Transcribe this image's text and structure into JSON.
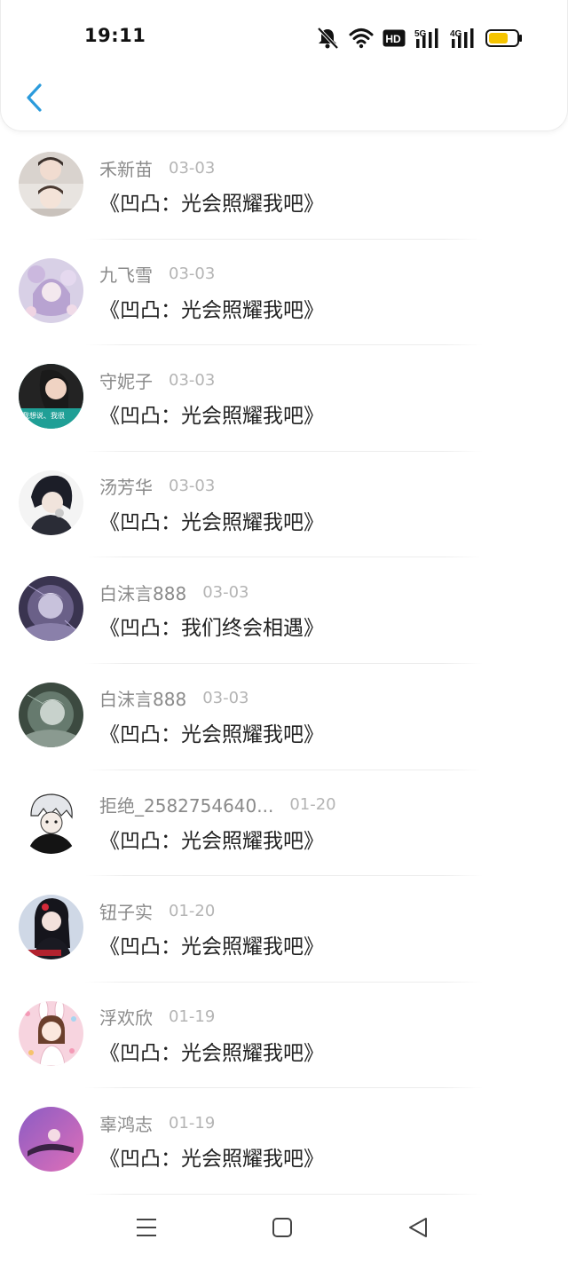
{
  "status_bar": {
    "time": "19:11",
    "icons": [
      "mute-bell-icon",
      "wifi-icon",
      "hd-icon",
      "5g-signal-icon",
      "4g-signal-icon",
      "battery-icon"
    ],
    "hd_label": "HD",
    "net5g_label": "5G",
    "net4g_label": "4G",
    "battery_color": "#f5c400"
  },
  "header": {
    "back_icon": "chevron-left-icon",
    "accent": "#2b9bdc"
  },
  "items": [
    {
      "name": "禾新苗",
      "date": "03-03",
      "title": "《凹凸：光会照耀我吧》"
    },
    {
      "name": "九飞雪",
      "date": "03-03",
      "title": "《凹凸：光会照耀我吧》"
    },
    {
      "name": "守妮子",
      "date": "03-03",
      "title": "《凹凸：光会照耀我吧》",
      "avatar_text": "我想说、我很"
    },
    {
      "name": "汤芳华",
      "date": "03-03",
      "title": "《凹凸：光会照耀我吧》"
    },
    {
      "name": "白沫言888",
      "date": "03-03",
      "title": "《凹凸：我们终会相遇》"
    },
    {
      "name": "白沫言888",
      "date": "03-03",
      "title": "《凹凸：光会照耀我吧》"
    },
    {
      "name": "拒绝_2582754640...",
      "date": "01-20",
      "title": "《凹凸：光会照耀我吧》"
    },
    {
      "name": "钮子实",
      "date": "01-20",
      "title": "《凹凸：光会照耀我吧》"
    },
    {
      "name": "浮欢欣",
      "date": "01-19",
      "title": "《凹凸：光会照耀我吧》"
    },
    {
      "name": "辜鸿志",
      "date": "01-19",
      "title": "《凹凸：光会照耀我吧》"
    }
  ],
  "navbar": {
    "icons": [
      "menu-icon",
      "home-square-icon",
      "back-triangle-icon"
    ]
  }
}
